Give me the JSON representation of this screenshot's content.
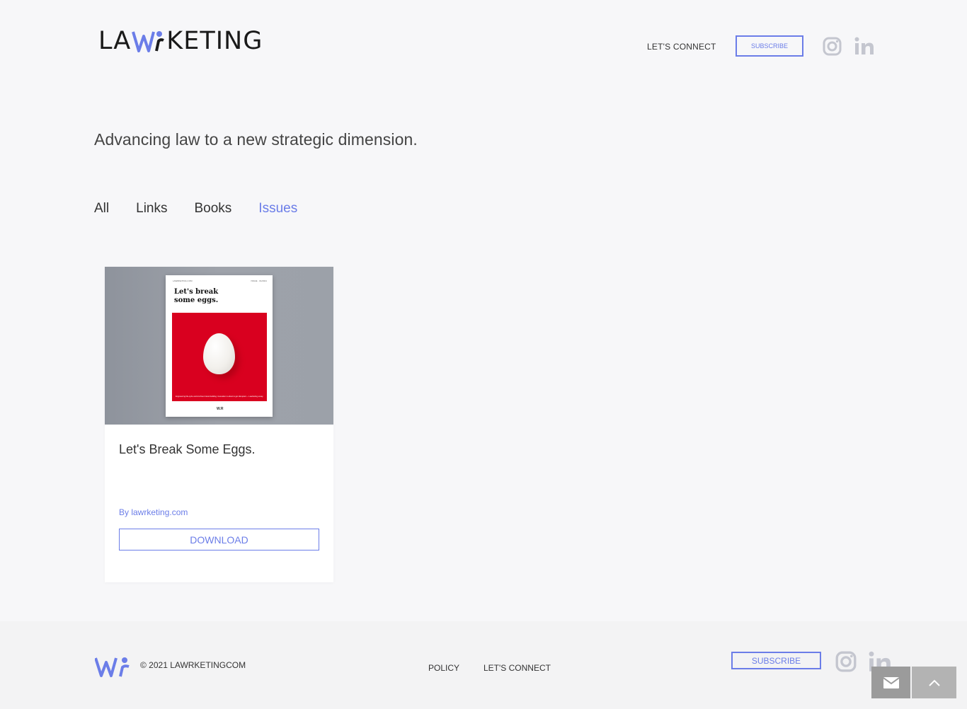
{
  "header": {
    "logo_left": "LA",
    "logo_right": "KETING",
    "nav_connect": "LET'S CONNECT",
    "subscribe_label": "SUBSCRIBE",
    "social": [
      "instagram-icon",
      "linkedin-icon"
    ]
  },
  "tagline": "Advancing law to a new strategic dimension.",
  "filters": {
    "items": [
      "All",
      "Links",
      "Books",
      "Issues"
    ],
    "active": "Issues"
  },
  "card": {
    "cover": {
      "small_left": "LAWRKETING.COM",
      "small_right": "ISSUE · 01/2021",
      "title_line1": "Let's break",
      "title_line2": "some eggs.",
      "caption": "Engineering life-cycle and AI-driven brand-building: innovation is about to get disrupted — Lawrketing essay reading",
      "mark": "W.R"
    },
    "title": "Let's Break Some Eggs.",
    "author": "By lawrketing.com",
    "download_label": "DOWNLOAD"
  },
  "footer": {
    "copyright": "© 2021 LAWRKETINGCOM",
    "policy_label": "POLICY",
    "connect_label": "LET'S CONNECT",
    "subscribe_label": "SUBSCRIBE"
  },
  "colors": {
    "accent": "#6b7de8",
    "background": "#f7f7f9",
    "footer_bg": "#f3f3f4",
    "cover_red": "#d9001f",
    "icon_gray": "#c4c6cf"
  }
}
